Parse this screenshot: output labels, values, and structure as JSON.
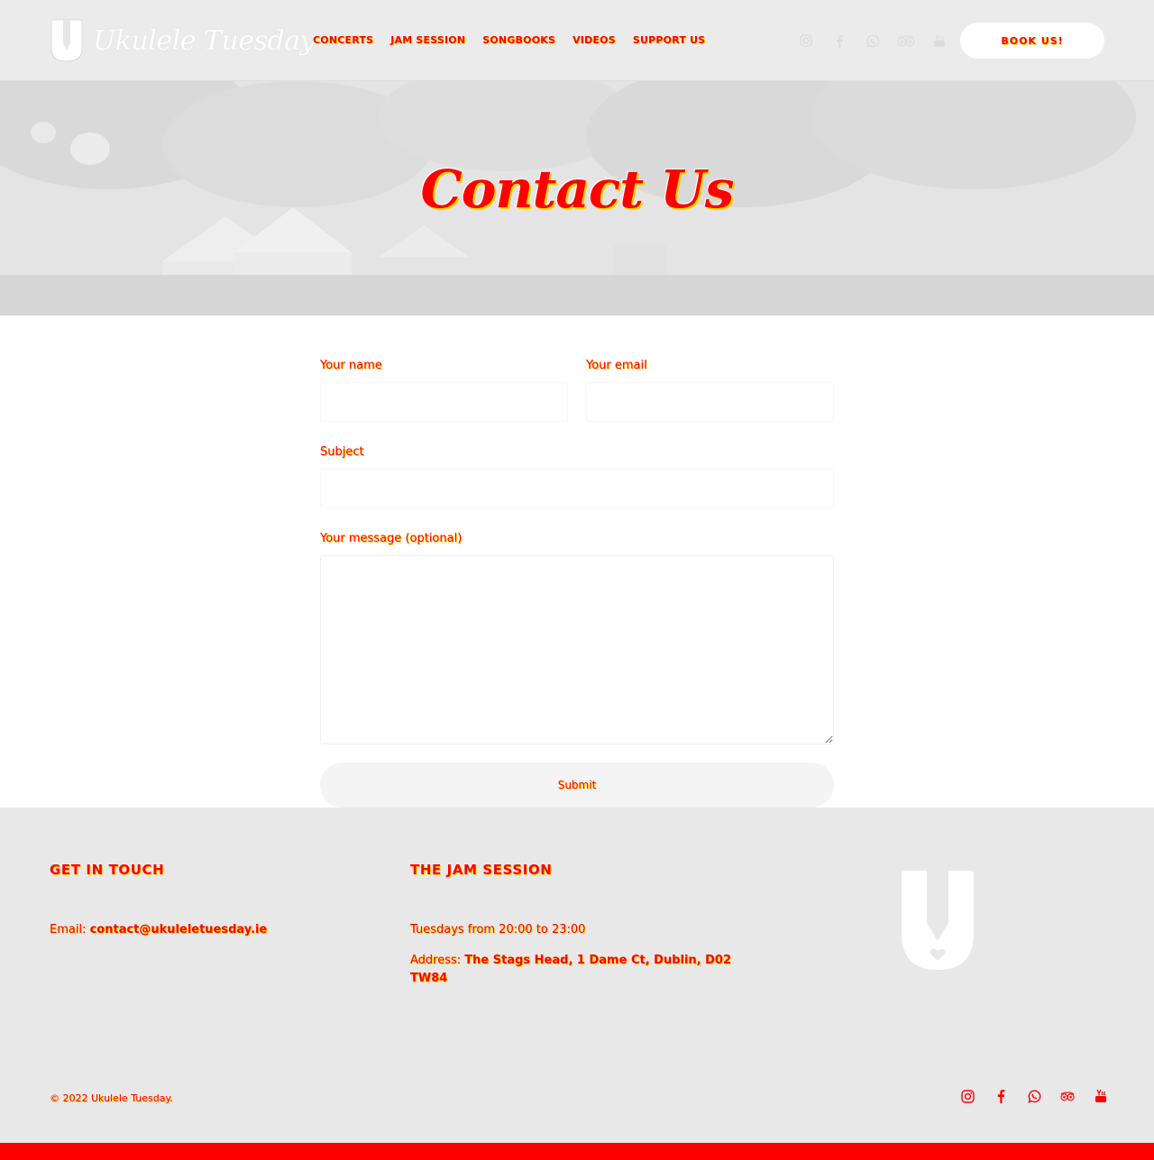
{
  "brand": {
    "name": "Ukulele Tuesday"
  },
  "nav": {
    "items": [
      {
        "label": "Concerts"
      },
      {
        "label": "Jam Session"
      },
      {
        "label": "Songbooks"
      },
      {
        "label": "Videos"
      },
      {
        "label": "Support us"
      }
    ]
  },
  "social": {
    "icons": [
      "instagram-icon",
      "facebook-icon",
      "whatsapp-icon",
      "tripadvisor-icon",
      "youtube-icon"
    ]
  },
  "header": {
    "book_label": "BOOK US!"
  },
  "hero": {
    "title": "Contact Us"
  },
  "form": {
    "name_label": "Your name",
    "email_label": "Your email",
    "subject_label": "Subject",
    "message_label": "Your message (optional)",
    "submit_label": "Submit"
  },
  "footer": {
    "contact": {
      "heading": "Get in touch",
      "email_prefix": "Email: ",
      "email_value": "contact@ukuleletuesday.ie"
    },
    "jam": {
      "heading": "The jam session",
      "schedule": "Tuesdays from 20:00 to 23:00",
      "address_prefix": "Address: ",
      "address_value": "The Stags Head, 1 Dame Ct, Dublin, D02 TW84"
    },
    "copyright": "© 2022 Ukulele Tuesday."
  },
  "colors": {
    "accent": "#ff0000",
    "highlight": "#ffd400",
    "header_bg": "#ebebeb",
    "footer_bg": "#e8e8e8"
  }
}
